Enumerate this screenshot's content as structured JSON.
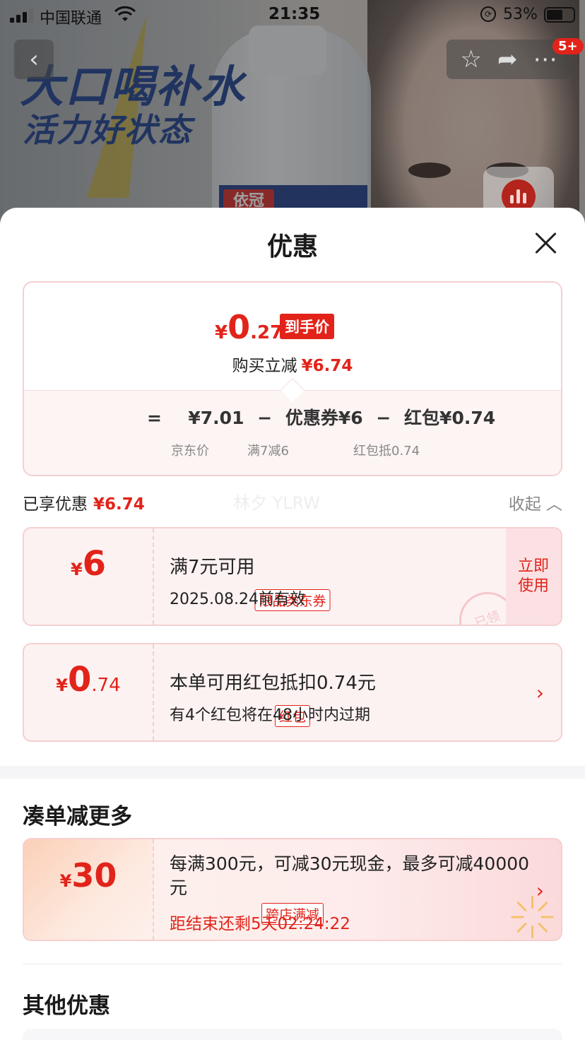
{
  "status_bar": {
    "carrier": "中国联通",
    "time": "21:35",
    "battery": "53%"
  },
  "banner": {
    "slogan_line1": "大口喝补水",
    "slogan_line2": "活力好状态",
    "bottle_label": "依冠",
    "message_badge": "5+"
  },
  "sheet": {
    "title": "优惠",
    "final_price": {
      "yen": "¥",
      "int": "0",
      "dec": ".27",
      "tag": "到手价"
    },
    "reduce_label": "购买立减",
    "reduce_amount": "¥6.74",
    "formula": {
      "eq": "=",
      "jd_price": "¥7.01",
      "minus1": "−",
      "coupon": "优惠券¥6",
      "minus2": "−",
      "redpacket": "红包¥0.74",
      "jd_price_label": "京东价",
      "coupon_label": "满7减6",
      "redpacket_label": "红包抵0.74"
    },
    "enjoyed_label": "已享优惠",
    "enjoyed_amount": "¥6.74",
    "watermark": "林夕 YLRW",
    "collapse_label": "收起",
    "coupons": [
      {
        "yen": "¥",
        "big": "6",
        "small": "",
        "tag": "限品类东券",
        "line1": "满7元可用",
        "line2": "2025.08.24前有效",
        "action": "立即使用",
        "stamp": "已领"
      },
      {
        "yen": "¥",
        "big": "0",
        "small": ".74",
        "tag": "红包",
        "line1": "本单可用红包抵扣0.74元",
        "line2": "有4个红包将在48小时内过期"
      }
    ],
    "more_section_title": "凑单减更多",
    "promo": {
      "yen": "¥",
      "big": "30",
      "tag": "跨店满减",
      "desc": "每满300元，可减30元现金，最多可减40000元",
      "timer": "距结束还剩5天02:24:22"
    },
    "other_section_title": "其他优惠"
  }
}
